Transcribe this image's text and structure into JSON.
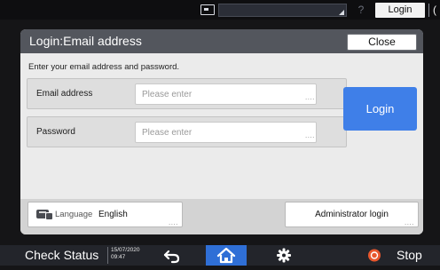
{
  "top_bar": {
    "login_label": "Login",
    "help_glyph": "?",
    "extra_glyph": "(",
    "icons": [
      "panel-display-icon",
      "help-icon"
    ]
  },
  "dialog": {
    "title": "Login:Email address",
    "close_label": "Close",
    "instruction": "Enter your email address and password.",
    "email": {
      "label": "Email address",
      "placeholder": "Please enter",
      "value": ""
    },
    "password": {
      "label": "Password",
      "placeholder": "Please enter",
      "value": ""
    },
    "login_label": "Login",
    "language": {
      "label": "Language",
      "value": "English",
      "icon": "language-keyboard-icon"
    },
    "admin_login_label": "Administrator login",
    "more_glyph": "...."
  },
  "bottom_bar": {
    "check_status_label": "Check Status",
    "date": "15/07/2020",
    "time": "09:47",
    "stop_label": "Stop",
    "icons": [
      "back-icon",
      "home-icon",
      "settings-gear-icon",
      "stop-icon"
    ]
  },
  "colors": {
    "accent_blue": "#3f7fe8",
    "home_blue": "#2f6fd6",
    "stop_orange": "#e8572d",
    "header_gray": "#53565d",
    "dialog_bg": "#ebebeb"
  }
}
